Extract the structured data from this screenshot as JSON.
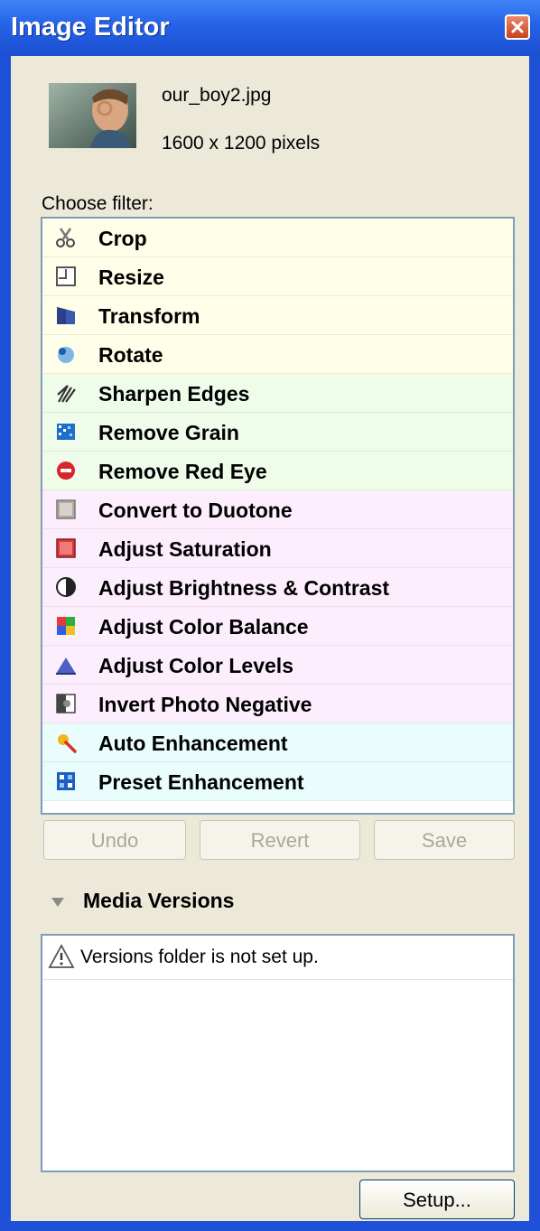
{
  "window": {
    "title": "Image Editor"
  },
  "image": {
    "filename": "our_boy2.jpg",
    "dimensions": "1600 x 1200 pixels"
  },
  "filters": {
    "label": "Choose filter:",
    "items": [
      {
        "label": "Crop",
        "icon": "scissors-icon"
      },
      {
        "label": "Resize",
        "icon": "resize-icon"
      },
      {
        "label": "Transform",
        "icon": "transform-icon"
      },
      {
        "label": "Rotate",
        "icon": "rotate-icon"
      },
      {
        "label": "Sharpen Edges",
        "icon": "sharpen-icon"
      },
      {
        "label": "Remove Grain",
        "icon": "grain-icon"
      },
      {
        "label": "Remove Red Eye",
        "icon": "red-eye-icon"
      },
      {
        "label": "Convert to Duotone",
        "icon": "duotone-icon"
      },
      {
        "label": "Adjust Saturation",
        "icon": "saturation-icon"
      },
      {
        "label": "Adjust Brightness & Contrast",
        "icon": "contrast-icon"
      },
      {
        "label": "Adjust Color Balance",
        "icon": "color-balance-icon"
      },
      {
        "label": "Adjust Color Levels",
        "icon": "levels-icon"
      },
      {
        "label": "Invert Photo Negative",
        "icon": "invert-icon"
      },
      {
        "label": "Auto Enhancement",
        "icon": "magic-wand-icon"
      },
      {
        "label": "Preset Enhancement",
        "icon": "preset-icon"
      }
    ]
  },
  "actions": {
    "undo": "Undo",
    "revert": "Revert",
    "save": "Save"
  },
  "media_versions": {
    "title": "Media Versions",
    "message": "Versions folder is not set up.",
    "setup_label": "Setup..."
  },
  "colors": {
    "titlebar": "#2562e6",
    "panel": "#ece9d8",
    "group_geometry": "#fefee9",
    "group_cleanup": "#effcea",
    "group_color": "#fdeefd",
    "group_enhance": "#e9fdfd"
  }
}
